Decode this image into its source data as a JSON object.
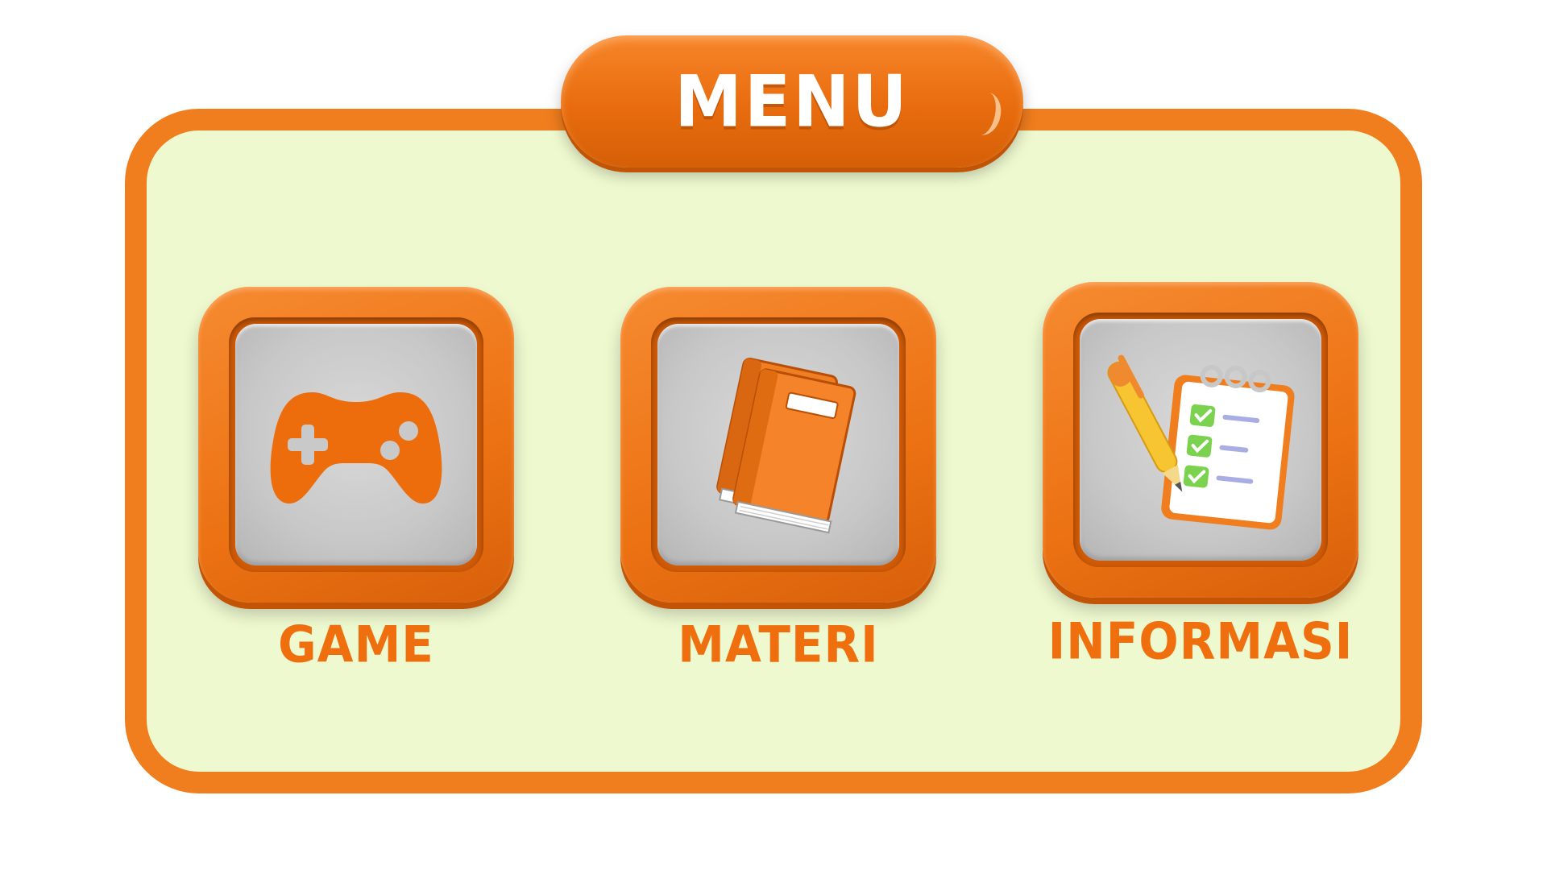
{
  "title": "MENU",
  "colors": {
    "accent_orange": "#f07d1e",
    "panel_background": "#eef9cf",
    "tile_face_gray": "#c8c8c8",
    "label_orange": "#ef6f0f"
  },
  "menu_items": [
    {
      "label": "GAME",
      "icon": "gamepad-icon"
    },
    {
      "label": "MATERI",
      "icon": "books-icon"
    },
    {
      "label": "INFORMASI",
      "icon": "checklist-notepad-icon"
    }
  ]
}
